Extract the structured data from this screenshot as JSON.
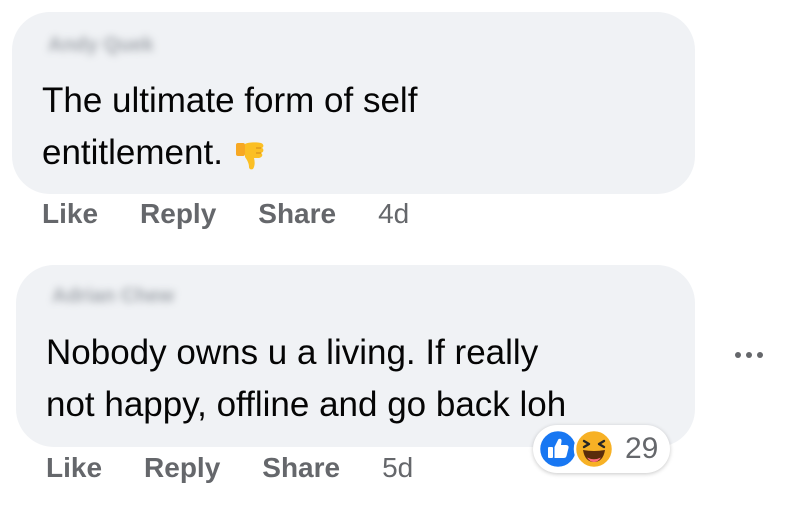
{
  "comments": [
    {
      "author": "Andy Quek",
      "text_lines": [
        "The ultimate form of self",
        "entitlement."
      ],
      "emoji": "thumbs-down-icon",
      "actions": {
        "like": "Like",
        "reply": "Reply",
        "share": "Share"
      },
      "time": "4d"
    },
    {
      "author": "Adrian Chew",
      "text_lines": [
        "Nobody owns u a living. If really",
        "not happy, offline and go back loh"
      ],
      "actions": {
        "like": "Like",
        "reply": "Reply",
        "share": "Share"
      },
      "time": "5d",
      "reactions": {
        "icons": [
          "like-reaction-icon",
          "haha-reaction-icon"
        ],
        "count": "29"
      }
    }
  ],
  "more_options": "more-options-icon",
  "colors": {
    "bubble": "#f0f2f5",
    "text": "#050505",
    "secondary": "#65676b",
    "like_blue": "#1877f2",
    "haha_yellow": "#f7b125"
  }
}
